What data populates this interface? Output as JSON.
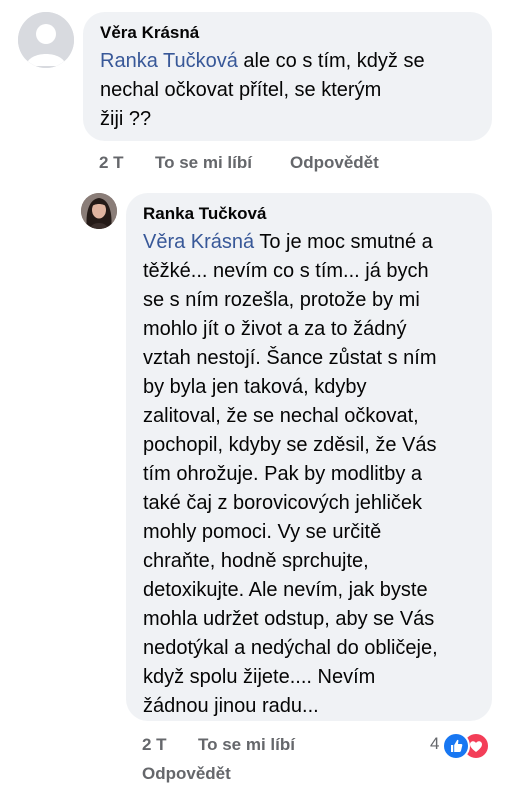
{
  "comments": [
    {
      "author": "Věra Krásná",
      "mention": "Ranka Tučková",
      "text_lines": [
        " ale co s tím, když se",
        "nechal očkovat přítel, se kterým",
        "žiji ??"
      ],
      "time": "2 T",
      "like_label": "To se mi líbí",
      "reply_label": "Odpovědět"
    },
    {
      "author": "Ranka Tučková",
      "mention": "Věra Krásná",
      "text_lines": [
        " To je moc smutné a",
        "těžké... nevím co s tím... já bych",
        "se s ním rozešla, protože by mi",
        "mohlo jít o život a za to žádný",
        "vztah nestojí. Šance zůstat s ním",
        "by byla jen taková, kdyby",
        "zalitoval, že se nechal očkovat,",
        "pochopil, kdyby se zděsil, že Vás",
        "tím ohrožuje. Pak by modlitby a",
        "také čaj z borovicových jehliček",
        "mohly pomoci. Vy se určitě",
        "chraňte, hodně sprchujte,",
        "detoxikujte. Ale nevím, jak byste",
        "mohla udržet odstup, aby se Vás",
        "nedotýkal a nedýchal do obličeje,",
        "když spolu žijete.... Nevím",
        "žádnou jinou radu..."
      ],
      "time": "2 T",
      "like_label": "To se mi líbí",
      "reply_label": "Odpovědět",
      "reaction_count": "4",
      "reaction_icons": [
        "like-icon",
        "love-icon"
      ]
    }
  ],
  "colors": {
    "bubble": "#f0f2f5",
    "mention": "#385898",
    "meta": "#65676b",
    "like": "#1877f2",
    "love": "#f33e58"
  }
}
